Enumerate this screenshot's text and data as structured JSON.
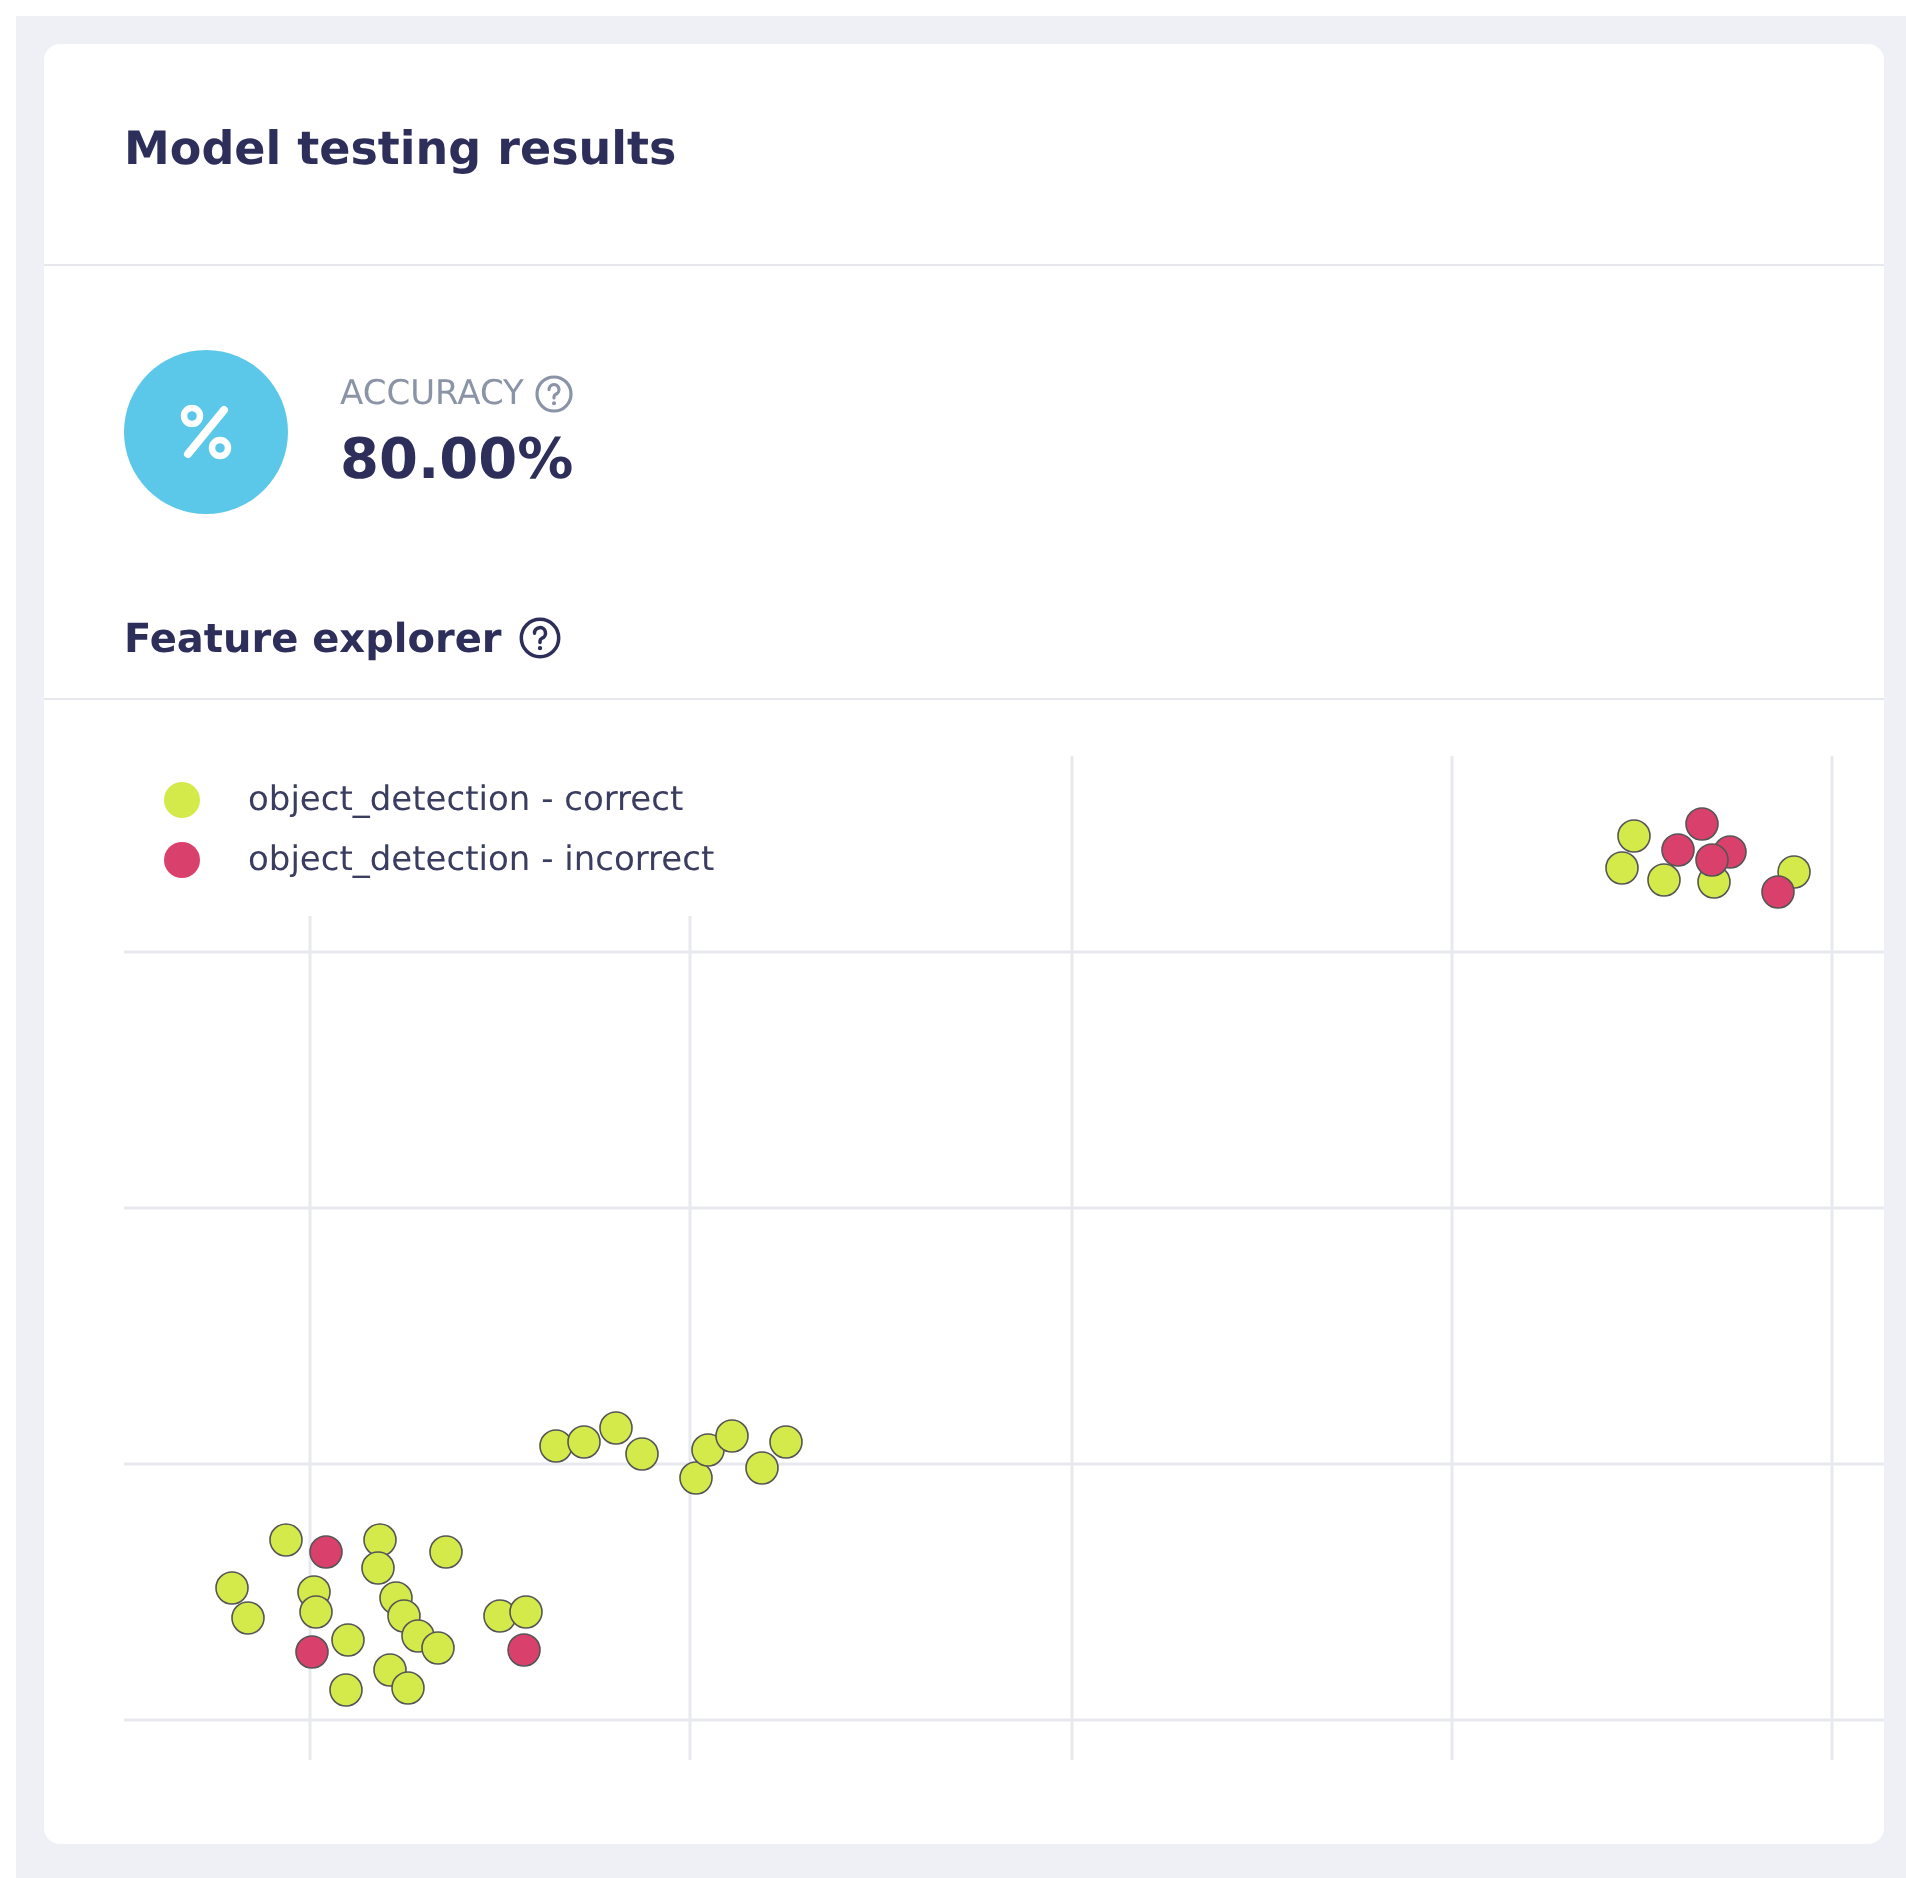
{
  "card": {
    "title": "Model testing results"
  },
  "metric": {
    "label": "ACCURACY",
    "value": "80.00%"
  },
  "feature_explorer": {
    "title": "Feature explorer",
    "legend": [
      {
        "label": "object_detection - correct",
        "color": "#d4ea4b"
      },
      {
        "label": "object_detection - incorrect",
        "color": "#d9406c"
      }
    ]
  }
}
